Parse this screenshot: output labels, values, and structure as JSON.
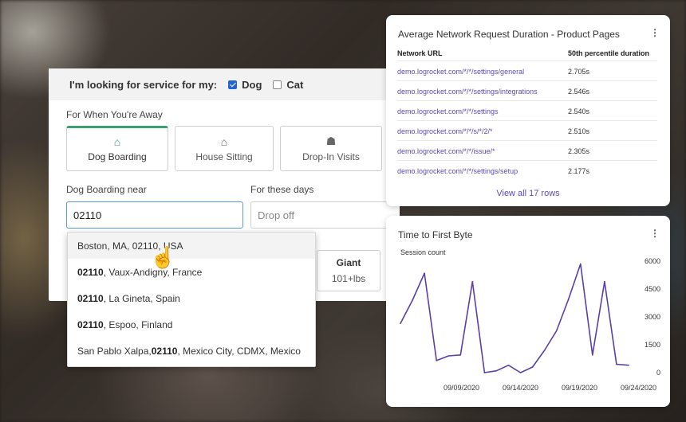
{
  "booking": {
    "heading": "I'm looking for service for my:",
    "pets": [
      {
        "label": "Dog",
        "checked": true
      },
      {
        "label": "Cat",
        "checked": false
      }
    ],
    "away_label": "For When You're Away",
    "services": [
      {
        "label": "Dog Boarding",
        "icon": "dog-boarding-icon",
        "active": true
      },
      {
        "label": "House Sitting",
        "icon": "house-sitting-icon",
        "active": false
      },
      {
        "label": "Drop-In Visits",
        "icon": "drop-in-visits-icon",
        "active": false
      }
    ],
    "near_label": "Dog Boarding near",
    "zip_value": "02110",
    "days_label": "For these days",
    "dropoff_placeholder": "Drop off",
    "size_option": {
      "label": "Giant",
      "range": "101+lbs"
    }
  },
  "autocomplete": {
    "items": [
      {
        "pre": "Boston, MA, 0",
        "bold": "",
        "hl": "211",
        "post": "0, USA"
      },
      {
        "pre": "",
        "bold": "02110",
        "hl": "",
        "post": ", Vaux-Andigny, France"
      },
      {
        "pre": "",
        "bold": "02110",
        "hl": "",
        "post": ", La Gineta, Spain"
      },
      {
        "pre": "",
        "bold": "02110",
        "hl": "",
        "post": ", Espoo, Finland"
      },
      {
        "pre": "San Pablo Xalpa, ",
        "bold": "02110",
        "hl": "",
        "post": ", Mexico City, CDMX, Mexico"
      }
    ]
  },
  "network_card": {
    "title": "Average Network Request Duration - Product Pages",
    "menu": "⋮",
    "col_url": "Network URL",
    "col_duration": "50th percentile duration",
    "rows": [
      {
        "url": "demo.logrocket.com/*/*/settings/general",
        "duration": "2.705s"
      },
      {
        "url": "demo.logrocket.com/*/*/settings/integrations",
        "duration": "2.546s"
      },
      {
        "url": "demo.logrocket.com/*/*/settings",
        "duration": "2.540s"
      },
      {
        "url": "demo.logrocket.com/*/*/s/*/2/*",
        "duration": "2.510s"
      },
      {
        "url": "demo.logrocket.com/*/*/issue/*",
        "duration": "2.305s"
      },
      {
        "url": "demo.logrocket.com/*/*/settings/setup",
        "duration": "2.177s"
      }
    ],
    "view_all": "View all 17 rows"
  },
  "ttfb_card": {
    "title": "Time to First Byte",
    "menu": "⋮"
  },
  "chart_data": {
    "type": "line",
    "title": "Time to First Byte",
    "ylabel": "Session count",
    "xlabel": "",
    "ylim": [
      0,
      6000
    ],
    "yticks": [
      "6000",
      "4500",
      "3000",
      "1500",
      "0"
    ],
    "xtick_labels": [
      "09/09/2020",
      "09/14/2020",
      "09/19/2020",
      "09/24/2020"
    ],
    "x": [
      "09/06/2020",
      "09/07/2020",
      "09/08/2020",
      "09/09/2020",
      "09/10/2020",
      "09/11/2020",
      "09/12/2020",
      "09/13/2020",
      "09/14/2020",
      "09/15/2020",
      "09/16/2020",
      "09/17/2020",
      "09/18/2020",
      "09/19/2020",
      "09/20/2020",
      "09/21/2020",
      "09/22/2020",
      "09/23/2020",
      "09/24/2020",
      "09/25/2020"
    ],
    "series": [
      {
        "color": "#5b3fa8",
        "values": [
          2650,
          3900,
          5350,
          650,
          900,
          950,
          4900,
          0,
          100,
          400,
          0,
          300,
          1200,
          2250,
          3950,
          5850,
          950,
          4900,
          450,
          400
        ]
      }
    ],
    "grid": false
  }
}
